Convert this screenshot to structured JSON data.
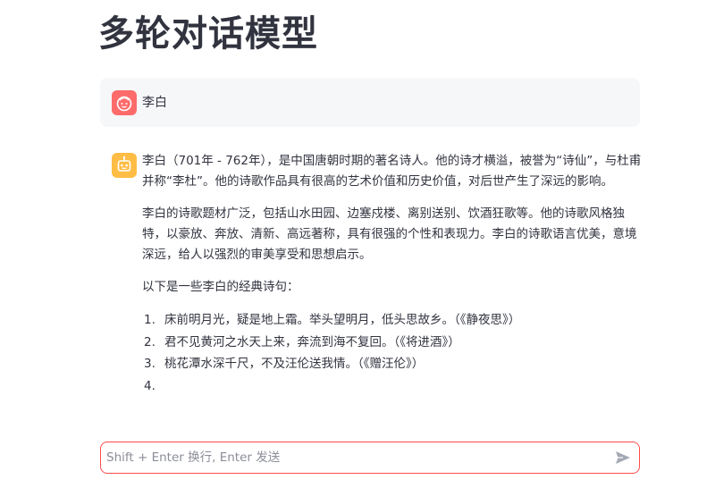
{
  "page": {
    "title": "多轮对话模型"
  },
  "messages": {
    "user": {
      "text": "李白",
      "avatar_icon": "face-icon",
      "avatar_color": "#ff6b6b"
    },
    "assistant": {
      "avatar_icon": "bot-icon",
      "avatar_color": "#ffbd45",
      "paragraphs": [
        "李白（701年 - 762年），是中国唐朝时期的著名诗人。他的诗才横溢，被誉为“诗仙”，与杜甫并称“李杜”。他的诗歌作品具有很高的艺术价值和历史价值，对后世产生了深远的影响。",
        "李白的诗歌题材广泛，包括山水田园、边塞戍楼、离别送别、饮酒狂歌等。他的诗歌风格独特，以豪放、奔放、清新、高远著称，具有很强的个性和表现力。李白的诗歌语言优美，意境深远，给人以强烈的审美享受和思想启示。",
        "以下是一些李白的经典诗句："
      ],
      "poems": [
        {
          "num": "1.",
          "text": "床前明月光，疑是地上霜。举头望明月，低头思故乡。（《静夜思》）"
        },
        {
          "num": "2.",
          "text": "君不见黄河之水天上来，奔流到海不复回。（《将进酒》）"
        },
        {
          "num": "3.",
          "text": "桃花潭水深千尺，不及汪伦送我情。（《赠汪伦》）"
        },
        {
          "num": "4.",
          "text": ""
        }
      ]
    }
  },
  "chat_input": {
    "placeholder": "Shift + Enter 换行, Enter 发送",
    "value": "",
    "send_icon": "send-icon",
    "border_color": "#ff4b4b"
  }
}
